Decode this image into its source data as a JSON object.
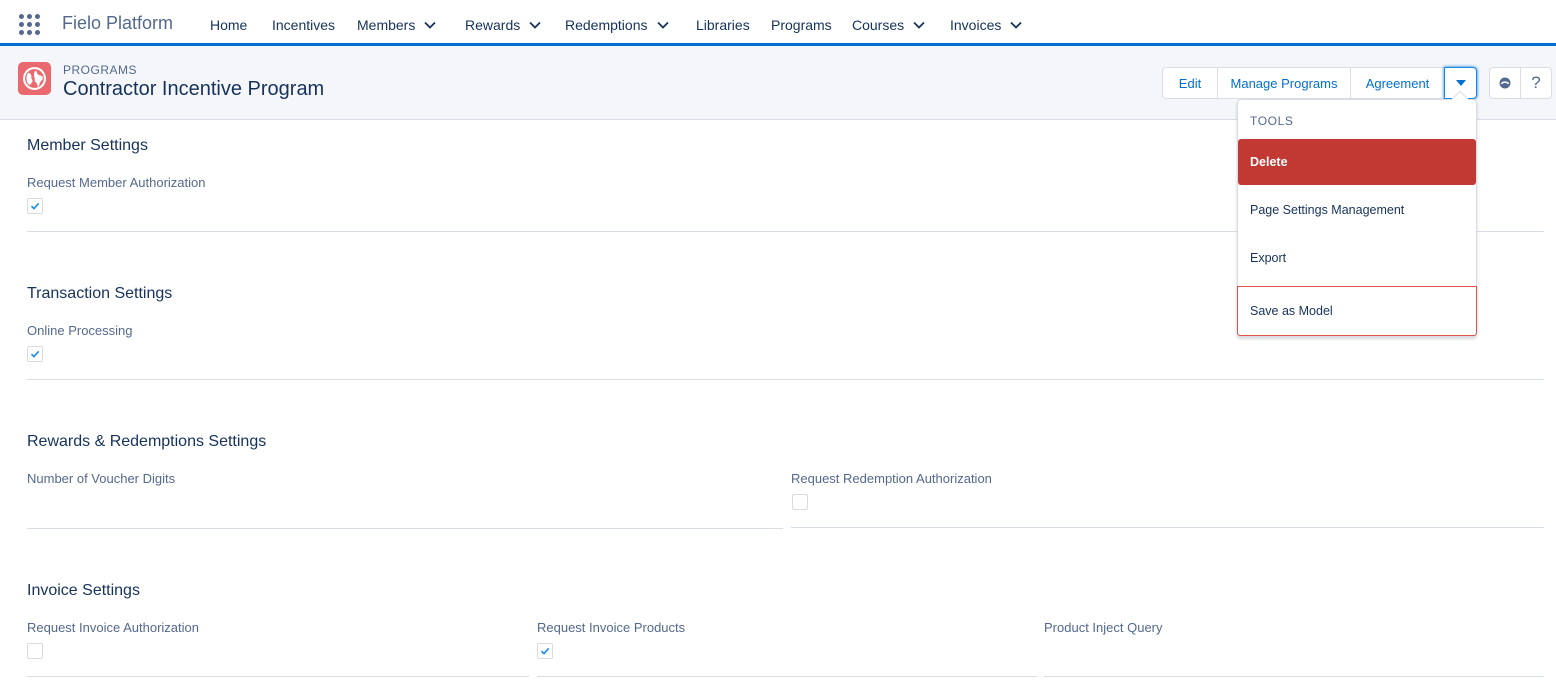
{
  "app": {
    "name": "Fielo Platform"
  },
  "nav": {
    "items": [
      {
        "label": "Home",
        "has_menu": false
      },
      {
        "label": "Incentives",
        "has_menu": false
      },
      {
        "label": "Members",
        "has_menu": true
      },
      {
        "label": "Rewards",
        "has_menu": true
      },
      {
        "label": "Redemptions",
        "has_menu": true
      },
      {
        "label": "Libraries",
        "has_menu": false
      },
      {
        "label": "Programs",
        "has_menu": false
      },
      {
        "label": "Courses",
        "has_menu": true
      },
      {
        "label": "Invoices",
        "has_menu": true
      }
    ]
  },
  "header": {
    "object_type": "PROGRAMS",
    "title": "Contractor Incentive Program",
    "icon": "globe-icon",
    "actions": {
      "edit": "Edit",
      "manage_programs": "Manage Programs",
      "agreement": "Agreement"
    }
  },
  "tools_menu": {
    "heading": "TOOLS",
    "items": [
      {
        "label": "Delete",
        "style": "danger"
      },
      {
        "label": "Page Settings Management",
        "style": "normal"
      },
      {
        "label": "Export",
        "style": "normal"
      },
      {
        "label": "Save as Model",
        "style": "outlined"
      }
    ]
  },
  "sections": {
    "member": {
      "title": "Member Settings",
      "fields": [
        {
          "label": "Request Member Authorization",
          "checked": true
        }
      ]
    },
    "transaction": {
      "title": "Transaction Settings",
      "fields": [
        {
          "label": "Online Processing",
          "checked": true
        }
      ]
    },
    "rewards": {
      "title": "Rewards & Redemptions Settings",
      "fields": [
        {
          "label": "Number of Voucher Digits",
          "value": ""
        },
        {
          "label": "Request Redemption Authorization",
          "checked": false
        }
      ]
    },
    "invoice": {
      "title": "Invoice Settings",
      "fields": [
        {
          "label": "Request Invoice Authorization",
          "checked": false
        },
        {
          "label": "Request Invoice Products",
          "checked": true
        },
        {
          "label": "Product Inject Query",
          "value": ""
        }
      ]
    }
  },
  "colors": {
    "accent": "#0070d2",
    "danger": "#c23934",
    "object_icon": "#e9696e",
    "text": "#16325c",
    "muted": "#54698d"
  }
}
